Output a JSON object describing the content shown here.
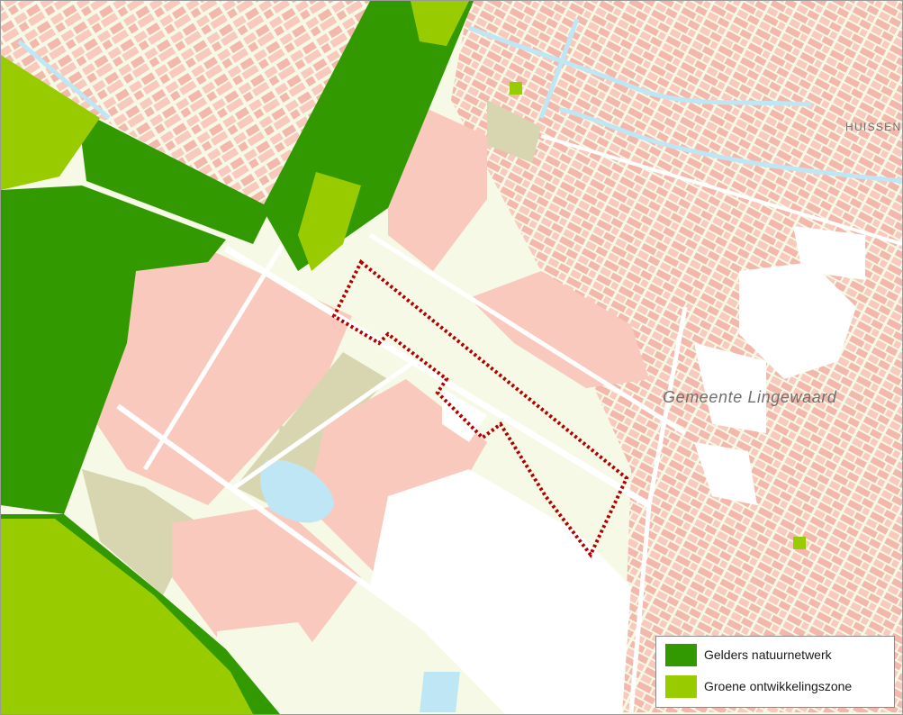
{
  "map": {
    "place_labels": {
      "huissen": "HUISSEN",
      "municipality": "Gemeente Lingewaard"
    },
    "plan_boundary": {
      "color": "#b20000",
      "style": "dotted"
    },
    "colors": {
      "background": "#f6f9e6",
      "building": "#f8c9bc",
      "building_alt": "#f3b8ab",
      "greenhouse_land": "#d8d6b0",
      "water": "#bfe6f5",
      "road": "#ffffff",
      "blank": "#ffffff",
      "natuurnetwerk": "#339900",
      "ontwikkelingszone": "#99cc00"
    }
  },
  "legend": {
    "items": [
      {
        "label": "Gelders natuurnetwerk",
        "color": "#339900"
      },
      {
        "label": "Groene ontwikkelingszone",
        "color": "#99cc00"
      }
    ]
  }
}
